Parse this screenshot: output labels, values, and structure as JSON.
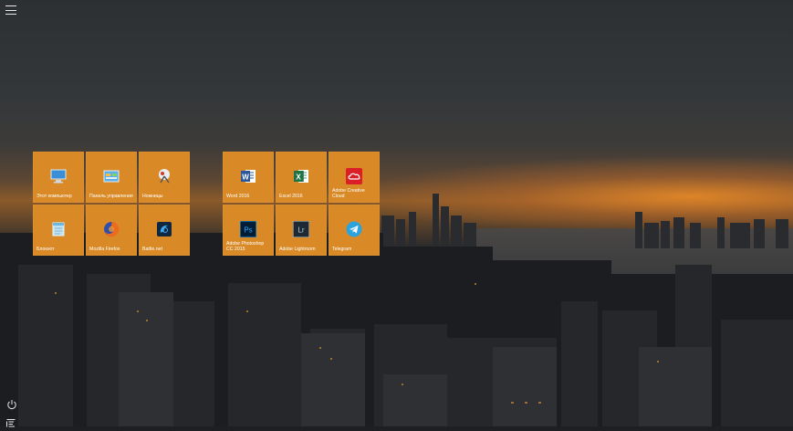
{
  "start_menu": {
    "menu_button": "hamburger-menu",
    "group1": {
      "tiles": [
        {
          "label": "Этот компьютер",
          "icon": "computer-icon"
        },
        {
          "label": "Панель управления",
          "icon": "control-panel-icon"
        },
        {
          "label": "Ножницы",
          "icon": "snipping-tool-icon"
        },
        {
          "label": "Блокнот",
          "icon": "notepad-icon"
        },
        {
          "label": "Mozilla Firefox",
          "icon": "firefox-icon"
        },
        {
          "label": "Battle.net",
          "icon": "battlenet-icon"
        }
      ]
    },
    "group2": {
      "tiles": [
        {
          "label": "Word 2016",
          "icon": "word-icon"
        },
        {
          "label": "Excel 2016",
          "icon": "excel-icon"
        },
        {
          "label": "Adobe Creative Cloud",
          "icon": "creative-cloud-icon"
        },
        {
          "label": "Adobe Photoshop CC 2015",
          "icon": "photoshop-icon"
        },
        {
          "label": "Adobe Lightroom",
          "icon": "lightroom-icon"
        },
        {
          "label": "Telegram",
          "icon": "telegram-icon"
        }
      ]
    },
    "power_icon": "power-icon",
    "all_apps_icon": "all-apps-icon"
  },
  "colors": {
    "tile": "#d98a26",
    "word": "#2b579a",
    "excel": "#217346",
    "creative_cloud": "#da1f26",
    "photoshop": "#001e36",
    "lightroom": "#1e2a33",
    "telegram": "#2aa3de"
  }
}
